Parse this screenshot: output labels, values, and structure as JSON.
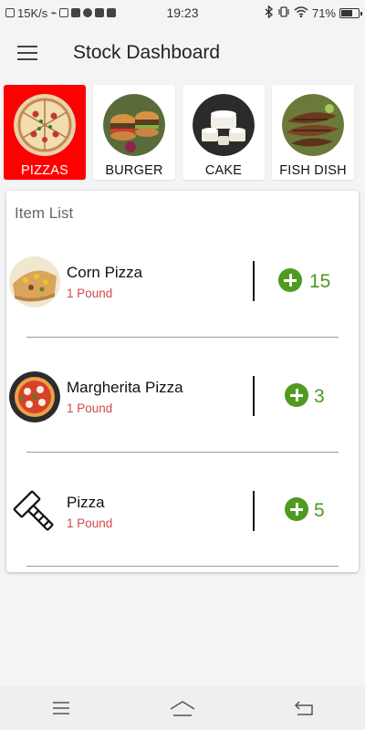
{
  "status_bar": {
    "network_speed": "15K/s",
    "time": "19:23",
    "battery_text": "71%",
    "battery_level": 0.71
  },
  "app_bar": {
    "title": "Stock Dashboard",
    "menu_icon": "hamburger-menu-icon"
  },
  "categories": [
    {
      "label": "PIZZAS",
      "active": true,
      "icon": "pizza-image"
    },
    {
      "label": "BURGER",
      "active": false,
      "icon": "burger-image"
    },
    {
      "label": "CAKE",
      "active": false,
      "icon": "cake-image"
    },
    {
      "label": "FISH DISH",
      "active": false,
      "icon": "fish-dish-image"
    }
  ],
  "item_list": {
    "title": "Item List",
    "items": [
      {
        "name": "Corn Pizza",
        "unit": "1 Pound",
        "quantity": "15",
        "image": "corn-pizza-image"
      },
      {
        "name": "Margherita Pizza",
        "unit": "1 Pound",
        "quantity": "3",
        "image": "margherita-pizza-image"
      },
      {
        "name": "Pizza",
        "unit": "1 Pound",
        "quantity": "5",
        "image": "hammer-icon"
      }
    ]
  },
  "colors": {
    "active_category": "#ff0000",
    "add_button": "#4f9a1f",
    "unit_text": "#d24a4a"
  },
  "nav_bar": {
    "menu_icon": "recent-apps-icon",
    "home_icon": "home-icon",
    "back_icon": "back-icon"
  }
}
